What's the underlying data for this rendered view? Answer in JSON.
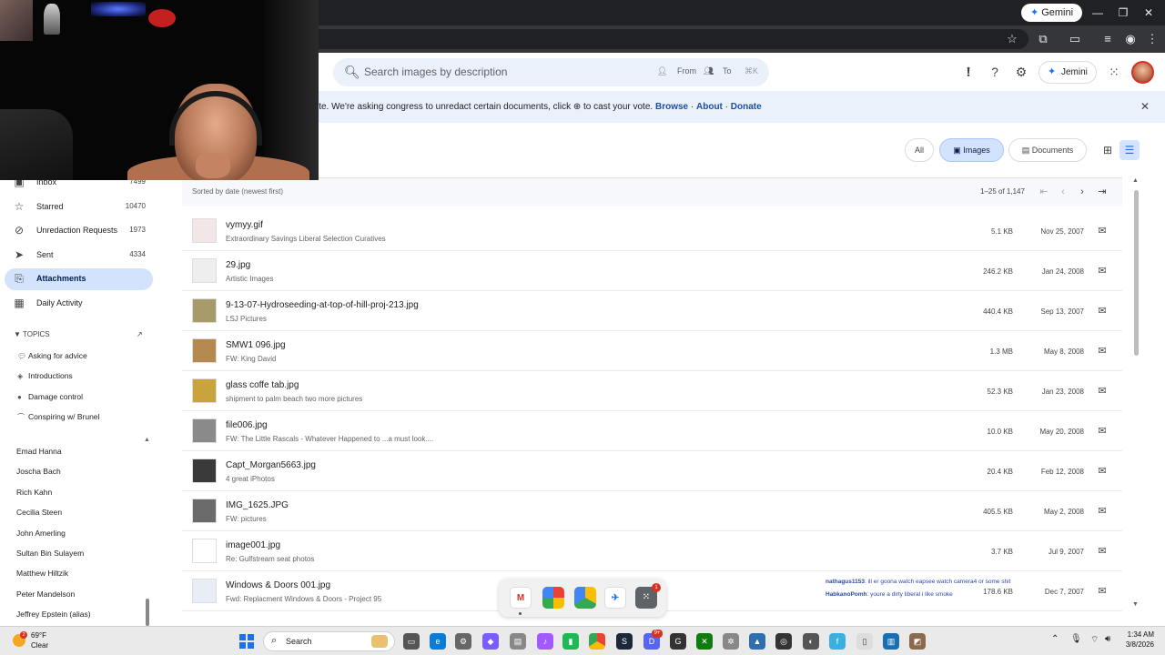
{
  "browser": {
    "gemini_label": "Gemini"
  },
  "header": {
    "search_placeholder": "Search images by description",
    "from_label": "From",
    "to_label": "To",
    "jemini_label": "Jemini"
  },
  "banner": {
    "text": "ite. We're asking congress to unredact certain documents, click",
    "text2": "to cast your vote.",
    "browse": "Browse",
    "about": "About",
    "donate": "Donate",
    "sep": "·"
  },
  "filters": {
    "all": "All",
    "images": "Images",
    "documents": "Documents",
    "selected": "Images"
  },
  "sortbar": {
    "label": "Sorted by date (newest first)",
    "pagination": "1–25 of 1,147"
  },
  "rows": [
    {
      "name": "vymyy.gif",
      "sub": "Extraordinary Savings Liberal Selection Curatives",
      "size": "5.1 KB",
      "date": "Nov 25, 2007",
      "thumb": "#f2e6e6"
    },
    {
      "name": "29.jpg",
      "sub": "Artistic Images",
      "size": "246.2 KB",
      "date": "Jan 24, 2008",
      "thumb": "#eeeeee"
    },
    {
      "name": "9-13-07-Hydroseeding-at-top-of-hill-proj-213.jpg",
      "sub": "LSJ Pictures",
      "size": "440.4 KB",
      "date": "Sep 13, 2007",
      "thumb": "#a89b6a"
    },
    {
      "name": "SMW1 096.jpg",
      "sub": "FW: King David",
      "size": "1.3 MB",
      "date": "May 8, 2008",
      "thumb": "#b58a50"
    },
    {
      "name": "glass coffe tab.jpg",
      "sub": "shipment to palm beach two more pictures",
      "size": "52.3 KB",
      "date": "Jan 23, 2008",
      "thumb": "#c9a43c"
    },
    {
      "name": "file006.jpg",
      "sub": "FW: The Little Rascals - Whatever Happened to ...a must look....",
      "size": "10.0 KB",
      "date": "May 20, 2008",
      "thumb": "#8a8a8a"
    },
    {
      "name": "Capt_Morgan5663.jpg",
      "sub": "4 great iPhotos",
      "size": "20.4 KB",
      "date": "Feb 12, 2008",
      "thumb": "#3a3a3a"
    },
    {
      "name": "IMG_1625.JPG",
      "sub": "FW: pictures",
      "size": "405.5 KB",
      "date": "May 2, 2008",
      "thumb": "#6b6b6b"
    },
    {
      "name": "image001.jpg",
      "sub": "Re: Gulfstream seat photos",
      "size": "3.7 KB",
      "date": "Jul 9, 2007",
      "thumb": "#ffffff"
    },
    {
      "name": "Windows & Doors 001.jpg",
      "sub": "Fwd: Replacment Windows & Doors - Project 95",
      "size": "178.6 KB",
      "date": "Dec 7, 2007",
      "thumb": "#e9edf5"
    }
  ],
  "sidebar": {
    "nav": [
      {
        "label": "Inbox",
        "count": "7499",
        "icon": "inbox-icon"
      },
      {
        "label": "Starred",
        "count": "10470",
        "icon": "star-icon"
      },
      {
        "label": "Unredaction Requests",
        "count": "1973",
        "icon": "eye-off-icon"
      },
      {
        "label": "Sent",
        "count": "4334",
        "icon": "send-icon"
      },
      {
        "label": "Attachments",
        "count": "",
        "icon": "paperclip-icon"
      },
      {
        "label": "Daily Activity",
        "count": "",
        "icon": "calendar-icon"
      }
    ],
    "selected": "Attachments",
    "topics_header": "TOPICS",
    "topics": [
      "Asking for advice",
      "Introductions",
      "Damage control",
      "Conspiring w/ Brunel"
    ],
    "people": [
      "Emad Hanna",
      "Joscha Bach",
      "Rich Kahn",
      "Cecilia Steen",
      "John Amerling",
      "Sultan Bin Sulayem",
      "Matthew Hiltzik",
      "Peter Mandelson",
      "Jeffrey Epstein (alias)"
    ]
  },
  "dock": {
    "badge": "1"
  },
  "chat": {
    "line1_name": "nathagus1153",
    "line1_text": ": ill er goona watch eapsee watch camera4 or some shit",
    "line2_name": "HabkanoPomh",
    "line2_text": ": youre a dirty liberal i like smoke"
  },
  "taskbar": {
    "temp": "69°F",
    "condition": "Clear",
    "weather_badge": "2",
    "search_label": "Search",
    "discord_badge": "9+",
    "time": "1:34 AM",
    "date": "3/8/2026"
  },
  "colors": {
    "accent": "#1a73e8",
    "selected_bg": "#d3e3fd",
    "banner_bg": "#eaf1fb"
  }
}
